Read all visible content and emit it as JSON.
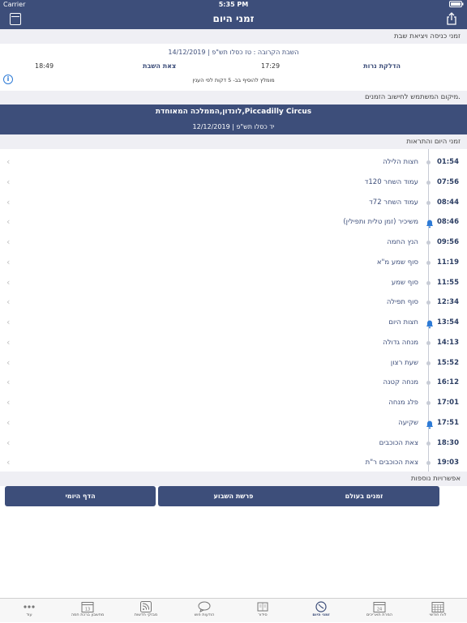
{
  "status_bar": {
    "carrier": "Carrier",
    "time": "5:35 PM"
  },
  "nav": {
    "title": "זמני היום"
  },
  "shabbat_section": {
    "header": "זמני כניסה ויציאת שבת",
    "date_line": "השבת הקרובה : טז כסלו תש\"פ | 14/12/2019",
    "candle_label": "הדלקת נרות",
    "candle_time": "17:29",
    "end_label": "צאת השבת",
    "end_time": "18:49",
    "note": "מומלץ להוסיף בב- 5 דקות לפי הענין"
  },
  "location_section": {
    "header": "מיקום המשתמש לחישוב הזמנים.",
    "location": "לונדון,הממלכה המאוחדת,Piccadilly Circus",
    "date": "יד כסלו תש\"פ | 12/12/2019"
  },
  "times_section": {
    "header": "זמני היום והתראות",
    "rows": [
      {
        "time": "01:54",
        "name": "חצות הלילה"
      },
      {
        "time": "07:56",
        "name": "עמוד השחר 120ד"
      },
      {
        "time": "08:44",
        "name": "עמוד השחר 72ד"
      },
      {
        "time": "08:46",
        "name": "משיכיר (זמן טלית ותפילין)"
      },
      {
        "time": "09:56",
        "name": "הנץ החמה"
      },
      {
        "time": "11:19",
        "name": "סוף שמע מ\"א"
      },
      {
        "time": "11:55",
        "name": "סוף שמע"
      },
      {
        "time": "12:34",
        "name": "סוף תפילה"
      },
      {
        "time": "13:54",
        "name": "חצות היום"
      },
      {
        "time": "14:13",
        "name": "מנחה גדולה"
      },
      {
        "time": "15:52",
        "name": "שעת רצון"
      },
      {
        "time": "16:12",
        "name": "מנחה קטנה"
      },
      {
        "time": "17:01",
        "name": "פלג מנחה"
      },
      {
        "time": "17:51",
        "name": "שקיעה"
      },
      {
        "time": "18:30",
        "name": "צאת הכוכבים"
      },
      {
        "time": "19:03",
        "name": "צאת הכוכבים ר\"ת"
      }
    ]
  },
  "extra_section": {
    "header": "אפשרויות נוספות",
    "buttons": [
      "זמנים בעולם",
      "פרשת השבוע",
      "הדף היומי"
    ]
  },
  "tabbar": {
    "tabs": [
      {
        "label": "לוח חודשי",
        "icon": "calendar-grid-icon"
      },
      {
        "label": "המרת תאריכים",
        "icon": "calendar-day-icon",
        "badge": "24"
      },
      {
        "label": "זמני היום",
        "icon": "clock-icon",
        "active": true
      },
      {
        "label": "סידור",
        "icon": "book-icon"
      },
      {
        "label": "הודעות פוש",
        "icon": "chat-bubble-icon"
      },
      {
        "label": "מבזקי חדשות",
        "icon": "rss-icon"
      },
      {
        "label": "מחשבון ברכת חמה",
        "icon": "calendar-13-icon",
        "badge": "13"
      },
      {
        "label": "עוד",
        "icon": "more-dots-icon"
      }
    ]
  },
  "colors": {
    "primary": "#3d4e7a",
    "accent": "#2e7bd6",
    "background": "#efeff4"
  }
}
